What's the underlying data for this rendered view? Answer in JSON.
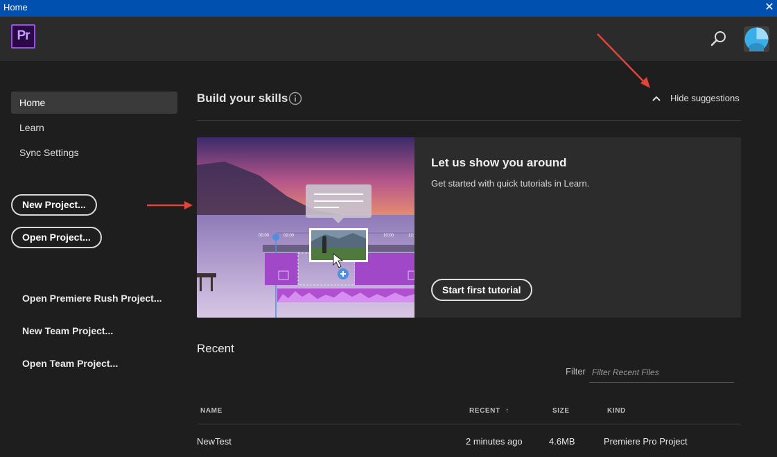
{
  "window": {
    "title": "Home",
    "close_glyph": "✕"
  },
  "appbar": {
    "logo_text": "Pr",
    "search_icon": "search-icon",
    "avatar_icon": "user-avatar"
  },
  "sidebar": {
    "nav": [
      {
        "label": "Home",
        "active": true
      },
      {
        "label": "Learn",
        "active": false
      },
      {
        "label": "Sync Settings",
        "active": false
      }
    ],
    "new_project": "New Project...",
    "open_project": "Open Project...",
    "links": [
      "Open Premiere Rush Project...",
      "New Team Project...",
      "Open Team Project..."
    ]
  },
  "skills": {
    "title": "Build your skills",
    "hide_label": "Hide suggestions"
  },
  "card": {
    "title": "Let us show you around",
    "description": "Get started with quick tutorials in Learn.",
    "button": "Start first tutorial",
    "timeline_labels": [
      "00:00",
      "02:00",
      "10:00",
      "12:"
    ]
  },
  "recent": {
    "title": "Recent",
    "filter_label": "Filter",
    "filter_placeholder": "Filter Recent Files",
    "columns": {
      "name": "NAME",
      "recent": "RECENT",
      "sort_glyph": "↑",
      "size": "SIZE",
      "kind": "KIND"
    },
    "rows": [
      {
        "name": "NewTest",
        "recent": "2 minutes ago",
        "size": "4.6MB",
        "kind": "Premiere Pro Project"
      }
    ]
  },
  "colors": {
    "accent_purple": "#9b4fe8",
    "titlebar_blue": "#0050b0",
    "annotation_red": "#e0443a"
  }
}
